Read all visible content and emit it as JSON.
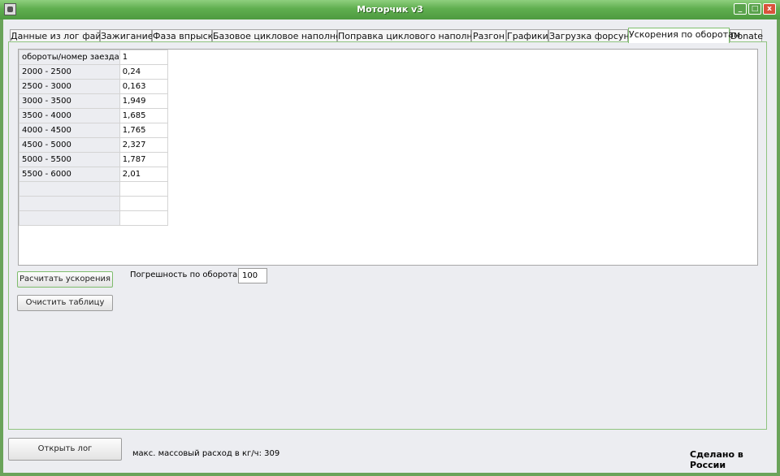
{
  "window": {
    "title": "Моторчик v3"
  },
  "title_buttons": {
    "min": "_",
    "max": "□",
    "close": "x"
  },
  "tabs": [
    "Данные из лог файла",
    "Зажигание",
    "Фаза впрыска",
    "Базовое цикловое наполнение",
    "Поправка циклового наполнения",
    "Разгон",
    "Графики",
    "Загрузка форсунок",
    "Ускорения по оборотам",
    "Donate"
  ],
  "active_tab": "Ускорения по оборотам",
  "table": {
    "headers": [
      "обороты/номер заезда",
      "1"
    ],
    "rows": [
      [
        "2000 - 2500",
        "0,24"
      ],
      [
        "2500 - 3000",
        "0,163"
      ],
      [
        "3000 - 3500",
        "1,949"
      ],
      [
        "3500 - 4000",
        "1,685"
      ],
      [
        "4000 - 4500",
        "1,765"
      ],
      [
        "4500 - 5000",
        "2,327"
      ],
      [
        "5000 - 5500",
        "1,787"
      ],
      [
        "5500 - 6000",
        "2,01"
      ],
      [
        "",
        ""
      ],
      [
        "",
        ""
      ],
      [
        "",
        ""
      ]
    ]
  },
  "buttons": {
    "calc": "Расчитать ускорения",
    "clear": "Очистить таблицу",
    "open_log": "Открыть лог"
  },
  "error_label": "Погрешность по оборотам:",
  "error_value": "100",
  "status": "макс. массовый расход в кг/ч: 309",
  "made_in": "Сделано в России"
}
